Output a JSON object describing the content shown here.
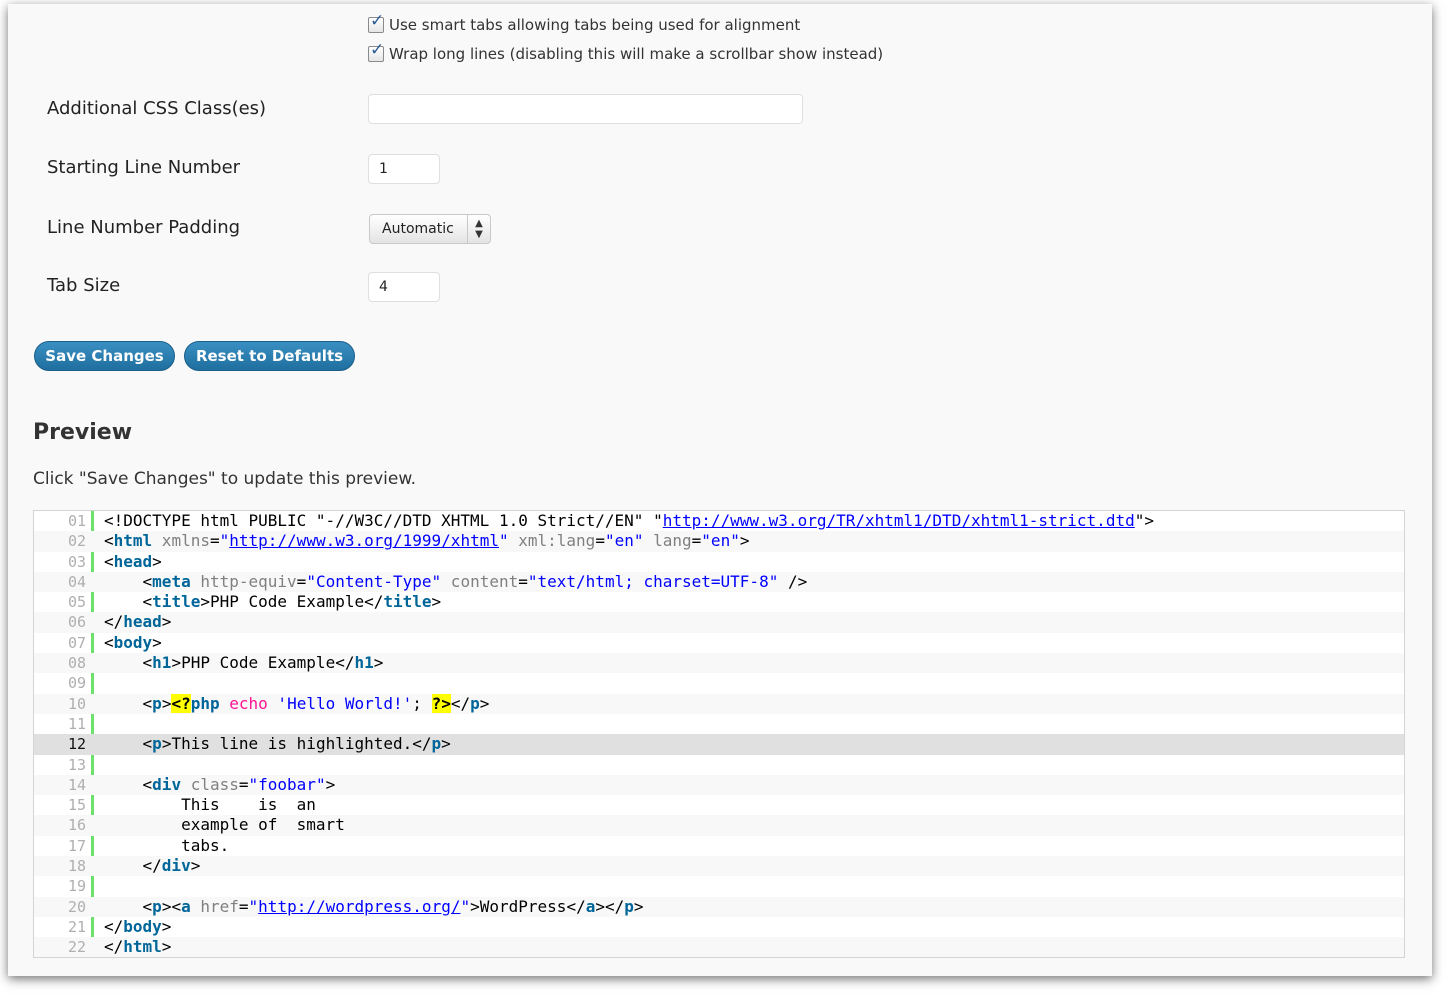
{
  "options": {
    "smart_tabs": {
      "label": "Use smart tabs allowing tabs being used for alignment",
      "checked": true
    },
    "wrap_lines": {
      "label": "Wrap long lines (disabling this will make a scrollbar show instead)",
      "checked": true
    }
  },
  "fields": {
    "css_class": {
      "label": "Additional CSS Class(es)",
      "value": ""
    },
    "start_line": {
      "label": "Starting Line Number",
      "value": "1"
    },
    "padding": {
      "label": "Line Number Padding",
      "value": "Automatic"
    },
    "tab_size": {
      "label": "Tab Size",
      "value": "4"
    }
  },
  "buttons": {
    "save": "Save Changes",
    "reset": "Reset to Defaults"
  },
  "preview": {
    "title": "Preview",
    "note": "Click \"Save Changes\" to update this preview.",
    "highlighted_line": 12,
    "gutter_color": "#6ce26c",
    "lines": [
      {
        "n": "01",
        "code": [
          [
            "p",
            "<!DOCTYPE html PUBLIC \"-//W3C//DTD XHTML 1.0 Strict//EN\" \""
          ],
          [
            "u",
            "http://www.w3.org/TR/xhtml1/DTD/xhtml1-strict.dtd"
          ],
          [
            "p",
            "\">"
          ]
        ]
      },
      {
        "n": "02",
        "code": [
          [
            "p",
            "<"
          ],
          [
            "t",
            "html"
          ],
          [
            "a",
            " xmlns"
          ],
          [
            "p",
            "="
          ],
          [
            "s",
            "\""
          ],
          [
            "u",
            "http://www.w3.org/1999/xhtml"
          ],
          [
            "s",
            "\""
          ],
          [
            "a",
            " xml:lang"
          ],
          [
            "p",
            "="
          ],
          [
            "s",
            "\"en\""
          ],
          [
            "a",
            " lang"
          ],
          [
            "p",
            "="
          ],
          [
            "s",
            "\"en\""
          ],
          [
            "p",
            ">"
          ]
        ]
      },
      {
        "n": "03",
        "code": [
          [
            "p",
            "<"
          ],
          [
            "t",
            "head"
          ],
          [
            "p",
            ">"
          ]
        ]
      },
      {
        "n": "04",
        "code": [
          [
            "p",
            "    <"
          ],
          [
            "t",
            "meta"
          ],
          [
            "a",
            " http-equiv"
          ],
          [
            "p",
            "="
          ],
          [
            "s",
            "\"Content-Type\""
          ],
          [
            "a",
            " content"
          ],
          [
            "p",
            "="
          ],
          [
            "s",
            "\"text/html; charset=UTF-8\""
          ],
          [
            "p",
            " />"
          ]
        ]
      },
      {
        "n": "05",
        "code": [
          [
            "p",
            "    <"
          ],
          [
            "t",
            "title"
          ],
          [
            "p",
            ">PHP Code Example</"
          ],
          [
            "t",
            "title"
          ],
          [
            "p",
            ">"
          ]
        ]
      },
      {
        "n": "06",
        "code": [
          [
            "p",
            "</"
          ],
          [
            "t",
            "head"
          ],
          [
            "p",
            ">"
          ]
        ]
      },
      {
        "n": "07",
        "code": [
          [
            "p",
            "<"
          ],
          [
            "t",
            "body"
          ],
          [
            "p",
            ">"
          ]
        ]
      },
      {
        "n": "08",
        "code": [
          [
            "p",
            "    <"
          ],
          [
            "t",
            "h1"
          ],
          [
            "p",
            ">PHP Code Example</"
          ],
          [
            "t",
            "h1"
          ],
          [
            "p",
            ">"
          ]
        ]
      },
      {
        "n": "09",
        "code": []
      },
      {
        "n": "10",
        "code": [
          [
            "p",
            "    <"
          ],
          [
            "t",
            "p"
          ],
          [
            "p",
            ">"
          ],
          [
            "php",
            "<?"
          ],
          [
            "ph",
            "php"
          ],
          [
            "kw",
            " echo"
          ],
          [
            "s",
            " 'Hello World!'"
          ],
          [
            "p",
            "; "
          ],
          [
            "php",
            "?>"
          ],
          [
            "p",
            "</"
          ],
          [
            "t",
            "p"
          ],
          [
            "p",
            ">"
          ]
        ]
      },
      {
        "n": "11",
        "code": []
      },
      {
        "n": "12",
        "code": [
          [
            "p",
            "    <"
          ],
          [
            "t",
            "p"
          ],
          [
            "p",
            ">This line is highlighted.</"
          ],
          [
            "t",
            "p"
          ],
          [
            "p",
            ">"
          ]
        ]
      },
      {
        "n": "13",
        "code": []
      },
      {
        "n": "14",
        "code": [
          [
            "p",
            "    <"
          ],
          [
            "t",
            "div"
          ],
          [
            "a",
            " class"
          ],
          [
            "p",
            "="
          ],
          [
            "s",
            "\"foobar\""
          ],
          [
            "p",
            ">"
          ]
        ]
      },
      {
        "n": "15",
        "code": [
          [
            "p",
            "        This    is  an"
          ]
        ]
      },
      {
        "n": "16",
        "code": [
          [
            "p",
            "        example of  smart"
          ]
        ]
      },
      {
        "n": "17",
        "code": [
          [
            "p",
            "        tabs."
          ]
        ]
      },
      {
        "n": "18",
        "code": [
          [
            "p",
            "    </"
          ],
          [
            "t",
            "div"
          ],
          [
            "p",
            ">"
          ]
        ]
      },
      {
        "n": "19",
        "code": []
      },
      {
        "n": "20",
        "code": [
          [
            "p",
            "    <"
          ],
          [
            "t",
            "p"
          ],
          [
            "p",
            "><"
          ],
          [
            "t",
            "a"
          ],
          [
            "a",
            " href"
          ],
          [
            "p",
            "="
          ],
          [
            "s",
            "\""
          ],
          [
            "u",
            "http://wordpress.org/"
          ],
          [
            "s",
            "\""
          ],
          [
            "p",
            ">WordPress</"
          ],
          [
            "t",
            "a"
          ],
          [
            "p",
            "></"
          ],
          [
            "t",
            "p"
          ],
          [
            "p",
            ">"
          ]
        ]
      },
      {
        "n": "21",
        "code": [
          [
            "p",
            "</"
          ],
          [
            "t",
            "body"
          ],
          [
            "p",
            ">"
          ]
        ]
      },
      {
        "n": "22",
        "code": [
          [
            "p",
            "</"
          ],
          [
            "t",
            "html"
          ],
          [
            "p",
            ">"
          ]
        ]
      }
    ]
  }
}
